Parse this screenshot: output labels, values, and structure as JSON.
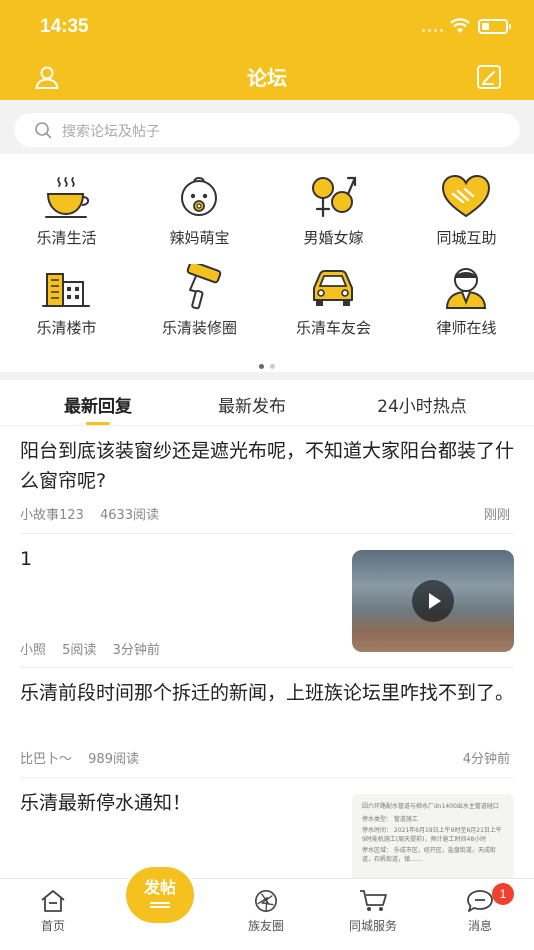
{
  "status_bar": {
    "time": "14:35"
  },
  "header": {
    "title": "论坛"
  },
  "search": {
    "placeholder": "搜索论坛及帖子"
  },
  "categories": [
    {
      "label": "乐清生活",
      "icon": "coffee-cup-icon"
    },
    {
      "label": "辣妈萌宝",
      "icon": "baby-face-icon"
    },
    {
      "label": "男婚女嫁",
      "icon": "gender-symbols-icon"
    },
    {
      "label": "同城互助",
      "icon": "handshake-heart-icon"
    },
    {
      "label": "乐清楼市",
      "icon": "buildings-icon"
    },
    {
      "label": "乐清装修圈",
      "icon": "paint-roller-icon"
    },
    {
      "label": "乐清车友会",
      "icon": "car-icon"
    },
    {
      "label": "律师在线",
      "icon": "lawyer-icon"
    }
  ],
  "tabs": [
    {
      "label": "最新回复",
      "active": true
    },
    {
      "label": "最新发布",
      "active": false
    },
    {
      "label": "24小时热点",
      "active": false
    }
  ],
  "posts": [
    {
      "title": "阳台到底该装窗纱还是遮光布呢，不知道大家阳台都装了什么窗帘呢?",
      "author": "小故事123",
      "reads": "4633阅读",
      "time": "刚刚"
    },
    {
      "title": "1",
      "author": "小照",
      "reads": "5阅读",
      "time": "3分钟前"
    },
    {
      "title": "乐清前段时间那个拆迁的新闻，上班族论坛里咋找不到了。",
      "author": "比巴卜～",
      "reads": "989阅读",
      "time": "4分钟前"
    },
    {
      "title": "乐清最新停水通知！"
    }
  ],
  "doc_thumb": {
    "line1": "因六环路配水管道与柳水厂dn1400出水主管道碰口",
    "line2": "停水类型：  管道施工",
    "line3": "停水时间：  2021年6月19日上午9时至6月21日上午9时能机施工(周天提前)，预计施工时间48小时",
    "line4": "停水区域：  乐成市区，经开区，盐盘街道，天成街道，石帆街道，镇……"
  },
  "nav": {
    "home": "首页",
    "post": "发帖",
    "circle": "族友圈",
    "services": "同城服务",
    "messages": "消息",
    "badge": "1"
  },
  "colors": {
    "brand": "#f5c11e",
    "badge": "#f0402e"
  }
}
